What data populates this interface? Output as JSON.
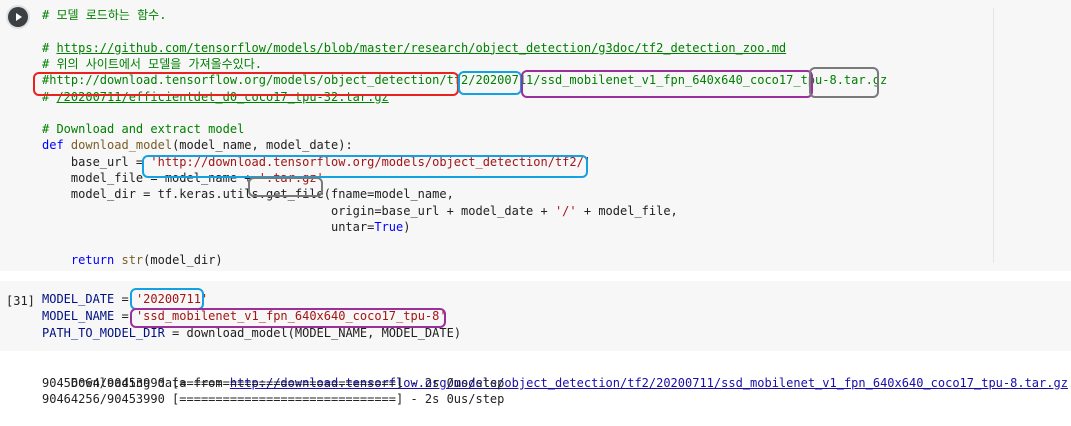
{
  "cell1": {
    "run_icon": "play-icon",
    "lines": [
      {
        "segs": [
          [
            "cmt",
            "# 모델 로드하는 함수."
          ]
        ]
      },
      {
        "segs": []
      },
      {
        "segs": [
          [
            "cmt",
            "# "
          ],
          [
            "link-c",
            "https://github.com/tensorflow/models/blob/master/research/object_detection/g3doc/tf2_detection_zoo.md"
          ]
        ]
      },
      {
        "segs": [
          [
            "cmt",
            "# 위의 사이트에서 모델을 가져올수있다."
          ]
        ]
      },
      {
        "segs": [
          [
            "cmt",
            "#http://download.tensorflow.org/models/object_detection/tf2/20200711/ssd_mobilenet_v1_fpn_640x640_coco17_tpu-8.tar.gz"
          ]
        ]
      },
      {
        "segs": [
          [
            "cmt",
            "# "
          ],
          [
            "link-c",
            "/20200711/efficientdet_d0_coco17_tpu-32.tar.gz"
          ]
        ]
      },
      {
        "segs": []
      },
      {
        "segs": [
          [
            "cmt",
            "# Download and extract model"
          ]
        ]
      },
      {
        "segs": [
          [
            "kw",
            "def "
          ],
          [
            "fn",
            "download_model"
          ],
          [
            "op",
            "(model_name, model_date):"
          ]
        ]
      },
      {
        "segs": [
          [
            "op",
            "    base_url = "
          ],
          [
            "str",
            "'http://download.tensorflow.org/models/object_detection/tf2/'"
          ]
        ]
      },
      {
        "segs": [
          [
            "op",
            "    model_file = model_name + "
          ],
          [
            "str",
            "'.tar.gz'"
          ]
        ]
      },
      {
        "segs": [
          [
            "op",
            "    model_dir = tf.keras.utils.get_file(fname=model_name,"
          ]
        ]
      },
      {
        "segs": [
          [
            "op",
            "                                        origin=base_url + model_date + "
          ],
          [
            "str",
            "'/'"
          ],
          [
            "op",
            " + model_file,"
          ]
        ]
      },
      {
        "segs": [
          [
            "op",
            "                                        untar="
          ],
          [
            "kw",
            "True"
          ],
          [
            "op",
            ")"
          ]
        ]
      },
      {
        "segs": []
      },
      {
        "segs": [
          [
            "kw",
            "    return "
          ],
          [
            "bi",
            "str"
          ],
          [
            "op",
            "(model_dir)"
          ]
        ]
      }
    ]
  },
  "cell2": {
    "exec_count": "[31]",
    "lines": [
      {
        "segs": [
          [
            "var",
            "MODEL_DATE"
          ],
          [
            "op",
            " = "
          ],
          [
            "str",
            "'20200711'"
          ]
        ]
      },
      {
        "segs": [
          [
            "var",
            "MODEL_NAME"
          ],
          [
            "op",
            " = "
          ],
          [
            "str",
            "'ssd_mobilenet_v1_fpn_640x640_coco17_tpu-8'"
          ]
        ]
      },
      {
        "segs": [
          [
            "var",
            "PATH_TO_MODEL_DIR"
          ],
          [
            "op",
            " = download_model(MODEL_NAME, MODEL_DATE)"
          ]
        ]
      }
    ]
  },
  "output": {
    "download_prefix": "Downloading data from ",
    "download_url": "http://download.tensorflow.org/models/object_detection/tf2/20200711/ssd_mobilenet_v1_fpn_640x640_coco17_tpu-8.tar.gz",
    "progress1": "90456064/90453990 [==============================] - 2s 0us/step",
    "progress2": "90464256/90453990 [==============================] - 2s 0us/step"
  }
}
